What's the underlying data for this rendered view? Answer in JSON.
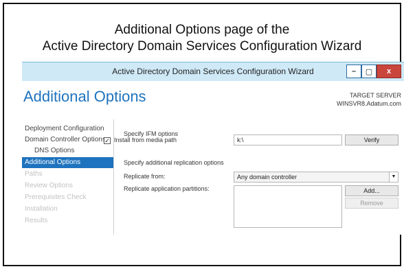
{
  "caption": {
    "line1": "Additional Options page of the",
    "line2": "Active Directory Domain Services Configuration Wizard"
  },
  "window": {
    "title": "Active Directory Domain Services Configuration Wizard",
    "controls": {
      "minimize": "–",
      "maximize": "▢",
      "close": "x"
    },
    "icons": {
      "minimize": "minimize-icon",
      "maximize": "maximize-icon",
      "close": "close-icon"
    }
  },
  "page": {
    "heading": "Additional Options",
    "target_label": "TARGET SERVER",
    "target_value": "WINSVR8.Adatum.com"
  },
  "nav": [
    {
      "label": "Deployment Configuration",
      "state": "normal",
      "indent": false
    },
    {
      "label": "Domain Controller Options",
      "state": "normal",
      "indent": false
    },
    {
      "label": "DNS Options",
      "state": "normal",
      "indent": true
    },
    {
      "label": "Additional Options",
      "state": "selected",
      "indent": false
    },
    {
      "label": "Paths",
      "state": "disabled",
      "indent": false
    },
    {
      "label": "Review Options",
      "state": "disabled",
      "indent": false
    },
    {
      "label": "Prerequisites Check",
      "state": "disabled",
      "indent": false
    },
    {
      "label": "Installation",
      "state": "disabled",
      "indent": false
    },
    {
      "label": "Results",
      "state": "disabled",
      "indent": false
    }
  ],
  "form": {
    "ifm_header": "Specify IFM options",
    "install_from_media_label": "Install from media path",
    "install_from_media_checked": true,
    "path_value": "k:\\",
    "verify_label": "Verify",
    "replication_header": "Specify additional replication options",
    "replicate_from_label": "Replicate from:",
    "replicate_from_value": "Any domain controller",
    "replicate_partitions_label": "Replicate application partitions:",
    "add_label": "Add...",
    "remove_label": "Remove"
  },
  "colors": {
    "accent": "#1e73be",
    "titlebar": "#cfe9f7",
    "close_button": "#c9463d",
    "disabled_text": "#c2c2c2"
  }
}
